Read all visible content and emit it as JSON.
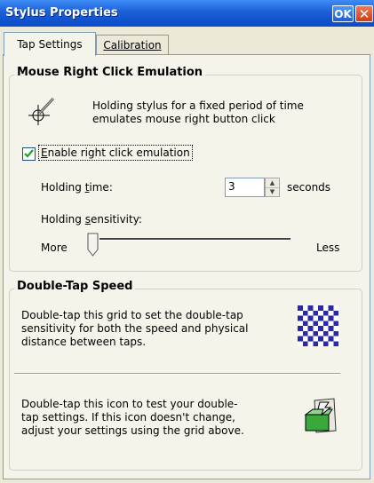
{
  "window": {
    "title": "Stylus Properties",
    "ok_label": "OK",
    "close_glyph": "✕"
  },
  "tabs": [
    {
      "label": "Tap Settings",
      "active": true
    },
    {
      "label": "Calibration",
      "active": false
    }
  ],
  "right_click": {
    "group_title": "Mouse Right Click Emulation",
    "icon": "stylus-crosshair-icon",
    "description_line1": "Holding stylus for a fixed period of time",
    "description_line2": "emulates mouse right button click",
    "checkbox_label": "Enable right click emulation",
    "checkbox_checked": true,
    "holding_time_label": "Holding time:",
    "holding_time_value": "3",
    "seconds_label": "seconds",
    "sensitivity_label": "Holding sensitivity:",
    "more_label": "More",
    "less_label": "Less",
    "sensitivity_level": 0
  },
  "double_tap": {
    "group_title": "Double-Tap Speed",
    "grid_text_line1": "Double-tap this grid to set the double-tap",
    "grid_text_line2": "sensitivity for both the speed and physical",
    "grid_text_line3": "distance between taps.",
    "grid_icon": "checker-grid-icon",
    "test_text_line1": "Double-tap this icon to test your double-",
    "test_text_line2": "tap settings. If this icon doesn't change,",
    "test_text_line3": "adjust your settings using the grid above.",
    "test_icon": "test-tap-icon"
  },
  "colors": {
    "titlebar": "#0b4bc8",
    "checker_blue": "#2a2aa6",
    "check_green": "#21a121"
  }
}
